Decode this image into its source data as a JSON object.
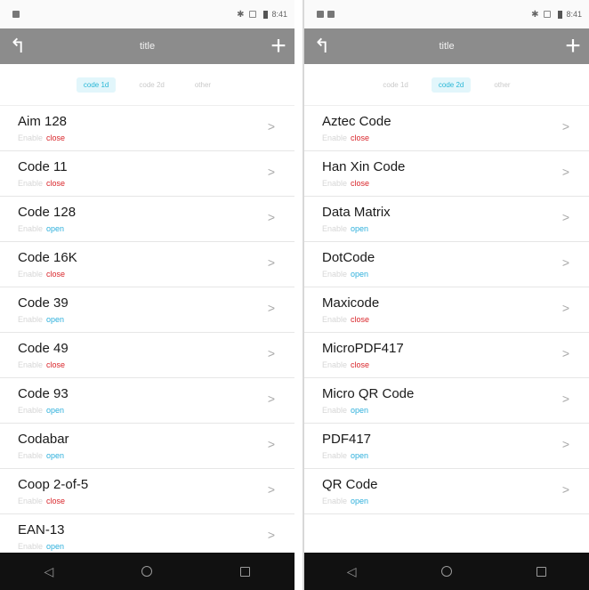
{
  "status": {
    "left": {
      "time": "8:41"
    },
    "right": {
      "time": "8:41"
    }
  },
  "screens": {
    "left": {
      "title": "title",
      "back_icon": "back-arrow-icon",
      "add_icon": "plus-icon",
      "tabs": [
        {
          "label": "code 1d",
          "active": true
        },
        {
          "label": "code 2d",
          "active": false
        },
        {
          "label": "other",
          "active": false
        }
      ],
      "items": [
        {
          "name": "Aim 128",
          "enable": "Enable",
          "state": "close"
        },
        {
          "name": "Code 11",
          "enable": "Enable",
          "state": "close"
        },
        {
          "name": "Code 128",
          "enable": "Enable",
          "state": "open"
        },
        {
          "name": "Code 16K",
          "enable": "Enable",
          "state": "close"
        },
        {
          "name": "Code 39",
          "enable": "Enable",
          "state": "open"
        },
        {
          "name": "Code 49",
          "enable": "Enable",
          "state": "close"
        },
        {
          "name": "Code 93",
          "enable": "Enable",
          "state": "open"
        },
        {
          "name": "Codabar",
          "enable": "Enable",
          "state": "open"
        },
        {
          "name": "Coop 2-of-5",
          "enable": "Enable",
          "state": "close"
        },
        {
          "name": "EAN-13",
          "enable": "Enable",
          "state": "open"
        }
      ]
    },
    "right": {
      "title": "title",
      "back_icon": "back-arrow-icon",
      "add_icon": "plus-icon",
      "tabs": [
        {
          "label": "code 1d",
          "active": false
        },
        {
          "label": "code 2d",
          "active": true
        },
        {
          "label": "other",
          "active": false
        }
      ],
      "items": [
        {
          "name": "Aztec Code",
          "enable": "Enable",
          "state": "close"
        },
        {
          "name": "Han Xin Code",
          "enable": "Enable",
          "state": "close"
        },
        {
          "name": "Data Matrix",
          "enable": "Enable",
          "state": "open"
        },
        {
          "name": "DotCode",
          "enable": "Enable",
          "state": "open"
        },
        {
          "name": "Maxicode",
          "enable": "Enable",
          "state": "close"
        },
        {
          "name": "MicroPDF417",
          "enable": "Enable",
          "state": "close"
        },
        {
          "name": "Micro QR Code",
          "enable": "Enable",
          "state": "open"
        },
        {
          "name": "PDF417",
          "enable": "Enable",
          "state": "open"
        },
        {
          "name": "QR Code",
          "enable": "Enable",
          "state": "open"
        }
      ]
    }
  },
  "colors": {
    "toolbar": "#8c8c8c",
    "tab_active_bg": "#e2f6fb",
    "tab_active_text": "#29b7d6",
    "state_close": "#d9262b",
    "state_open": "#2fb0dc",
    "navbar": "#111111"
  }
}
